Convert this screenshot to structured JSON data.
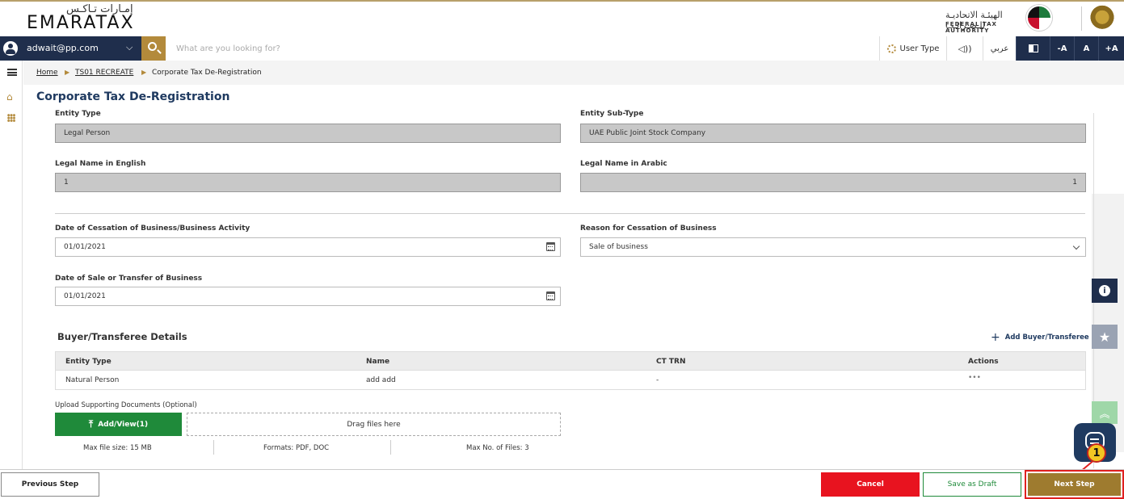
{
  "header": {
    "logo_arabic": "إمـارات تـاكـس",
    "logo_english": "EMARATAX",
    "authority_arabic": "الهيئـة الاتحاديـة للـضـرائـب",
    "authority_english": "FEDERAL TAX AUTHORITY"
  },
  "navbar": {
    "user_email": "adwait@pp.com",
    "search_placeholder": "What are you looking for?",
    "user_type_label": "User Type",
    "speaker_glyph": "◁))",
    "language_label": "عربي",
    "font_decrease": "-A",
    "font_normal": "A",
    "font_increase": "+A"
  },
  "breadcrumb": {
    "home": "Home",
    "parent": "TS01 RECREATE",
    "current": "Corporate Tax De-Registration"
  },
  "page": {
    "title": "Corporate Tax De-Registration"
  },
  "form": {
    "entity_type_label": "Entity Type",
    "entity_type_value": "Legal Person",
    "entity_subtype_label": "Entity Sub-Type",
    "entity_subtype_value": "UAE Public Joint Stock Company",
    "legal_name_en_label": "Legal Name in English",
    "legal_name_en_value": "1",
    "legal_name_ar_label": "Legal Name in Arabic",
    "legal_name_ar_value": "1",
    "cessation_date_label": "Date of Cessation of Business/Business Activity",
    "cessation_date_value": "01/01/2021",
    "cessation_reason_label": "Reason for Cessation of Business",
    "cessation_reason_value": "Sale of business",
    "sale_date_label": "Date of Sale or Transfer of Business",
    "sale_date_value": "01/01/2021"
  },
  "buyer": {
    "section_title": "Buyer/Transferee Details",
    "add_label": "Add Buyer/Transferee",
    "columns": [
      "Entity Type",
      "Name",
      "CT TRN",
      "Actions"
    ],
    "rows": [
      {
        "entity_type": "Natural Person",
        "name": "add add",
        "ct_trn": "-",
        "actions": "•••"
      }
    ]
  },
  "upload": {
    "label": "Upload Supporting Documents (Optional)",
    "button_label": "Add/View(1)",
    "dropzone_label": "Drag files here",
    "max_size": "Max file size: 15 MB",
    "formats": "Formats: PDF, DOC",
    "max_files": "Max No. of Files: 3"
  },
  "floating": {
    "info_glyph": "i",
    "star_glyph": "★",
    "up_glyph": "︽",
    "callout_number": "1"
  },
  "footer": {
    "previous_label": "Previous Step",
    "cancel_label": "Cancel",
    "draft_label": "Save as Draft",
    "next_label": "Next Step"
  },
  "colors": {
    "navy": "#1f2e4c",
    "gold": "#b38a3b",
    "green": "#1f8a3a",
    "red": "#e8131f",
    "next_brown": "#9e7b2f"
  }
}
